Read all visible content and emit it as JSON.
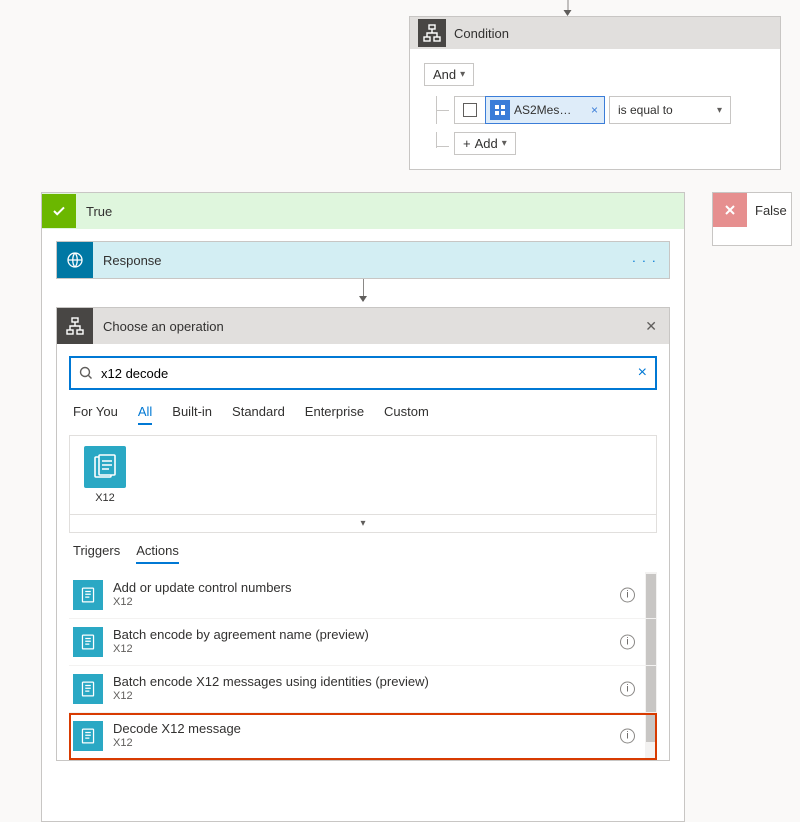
{
  "condition": {
    "title": "Condition",
    "connector": "And",
    "token_label": "AS2Mes…",
    "operator": "is equal to",
    "add_label": "Add"
  },
  "branches": {
    "true_label": "True",
    "false_label": "False"
  },
  "response": {
    "title": "Response"
  },
  "choose": {
    "title": "Choose an operation",
    "search_value": "x12 decode",
    "filters": [
      "For You",
      "All",
      "Built-in",
      "Standard",
      "Enterprise",
      "Custom"
    ],
    "filter_active": 1,
    "connector_tile": "X12",
    "tabs": [
      "Triggers",
      "Actions"
    ],
    "tab_active": 1,
    "actions": [
      {
        "name": "Add or update control numbers",
        "connector": "X12",
        "highlight": false
      },
      {
        "name": "Batch encode by agreement name (preview)",
        "connector": "X12",
        "highlight": false
      },
      {
        "name": "Batch encode X12 messages using identities (preview)",
        "connector": "X12",
        "highlight": false
      },
      {
        "name": "Decode X12 message",
        "connector": "X12",
        "highlight": true
      }
    ]
  }
}
